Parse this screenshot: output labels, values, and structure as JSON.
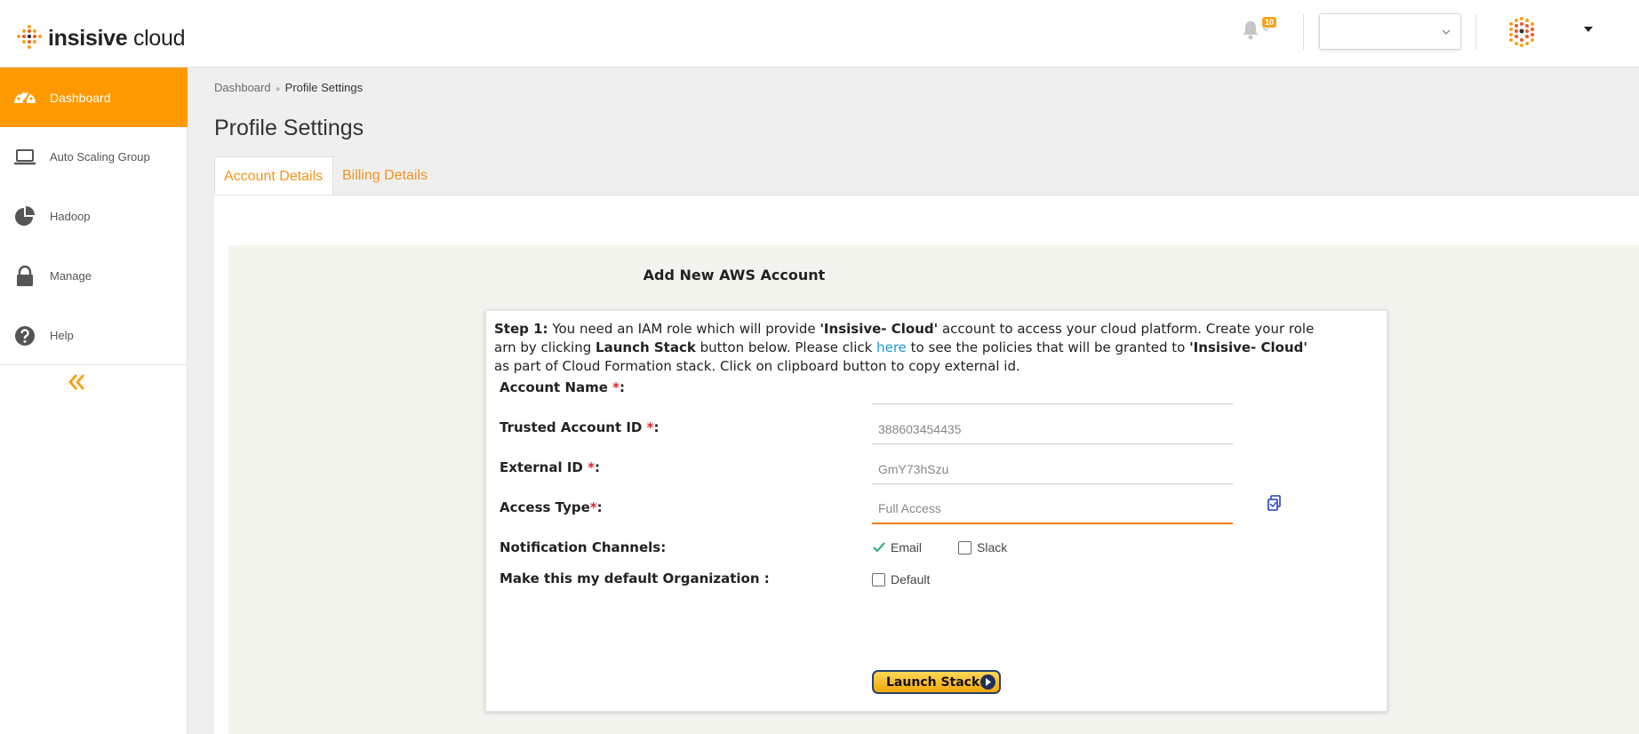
{
  "brand": {
    "name_bold": "insisive",
    "name_light": " cloud",
    "accent": "#ff9900"
  },
  "header": {
    "notifications_count": "10",
    "org_select_value": "",
    "user_name": ""
  },
  "sidebar": {
    "items": [
      {
        "label": "Dashboard",
        "icon": "dashboard-icon",
        "active": true
      },
      {
        "label": "Auto Scaling Group",
        "icon": "laptop-icon",
        "active": false
      },
      {
        "label": "Hadoop",
        "icon": "pie-chart-icon",
        "active": false
      },
      {
        "label": "Manage",
        "icon": "lock-icon",
        "active": false
      },
      {
        "label": "Help",
        "icon": "help-icon",
        "active": false
      }
    ],
    "collapse_icon": "double-chevron-left-icon"
  },
  "breadcrumb": {
    "root": "Dashboard",
    "current": "Profile Settings"
  },
  "page_title": "Profile Settings",
  "tabs": [
    {
      "label": "Account Details",
      "active": true
    },
    {
      "label": "Billing Details",
      "active": false
    }
  ],
  "form": {
    "title": "Add New AWS Account",
    "step": {
      "prefix": "Step 1:",
      "t1": " You need an IAM role which will provide ",
      "brand1": "'Insisive- Cloud'",
      "t2": " account to access your cloud platform. Create your role arn by clicking ",
      "launch_ref": "Launch Stack",
      "t3": " button below. Please click ",
      "link": "here",
      "t4": " to see the policies that will be granted to ",
      "brand2": "'Insisive- Cloud'",
      "t5": " as part of Cloud Formation stack. Click on clipboard button to copy external id."
    },
    "account_name": {
      "label": "Account Name ",
      "req": "*",
      "colon": ":",
      "value": ""
    },
    "trusted_account_id": {
      "label": "Trusted Account ID ",
      "req": "*",
      "colon": ":",
      "value": "388603454435"
    },
    "external_id": {
      "label": "External ID ",
      "req": "*",
      "colon": ":",
      "value": "GmY73hSzu"
    },
    "access_type": {
      "label": "Access Type",
      "req": "*",
      "colon": ":",
      "value": "Full Access"
    },
    "notification_channels": {
      "label": "Notification Channels:",
      "email": {
        "label": "Email",
        "checked": true
      },
      "slack": {
        "label": "Slack",
        "checked": false
      }
    },
    "default_org": {
      "label": "Make this my default Organization :",
      "option": {
        "label": "Default",
        "checked": false
      }
    },
    "launch_button": "Launch Stack"
  }
}
